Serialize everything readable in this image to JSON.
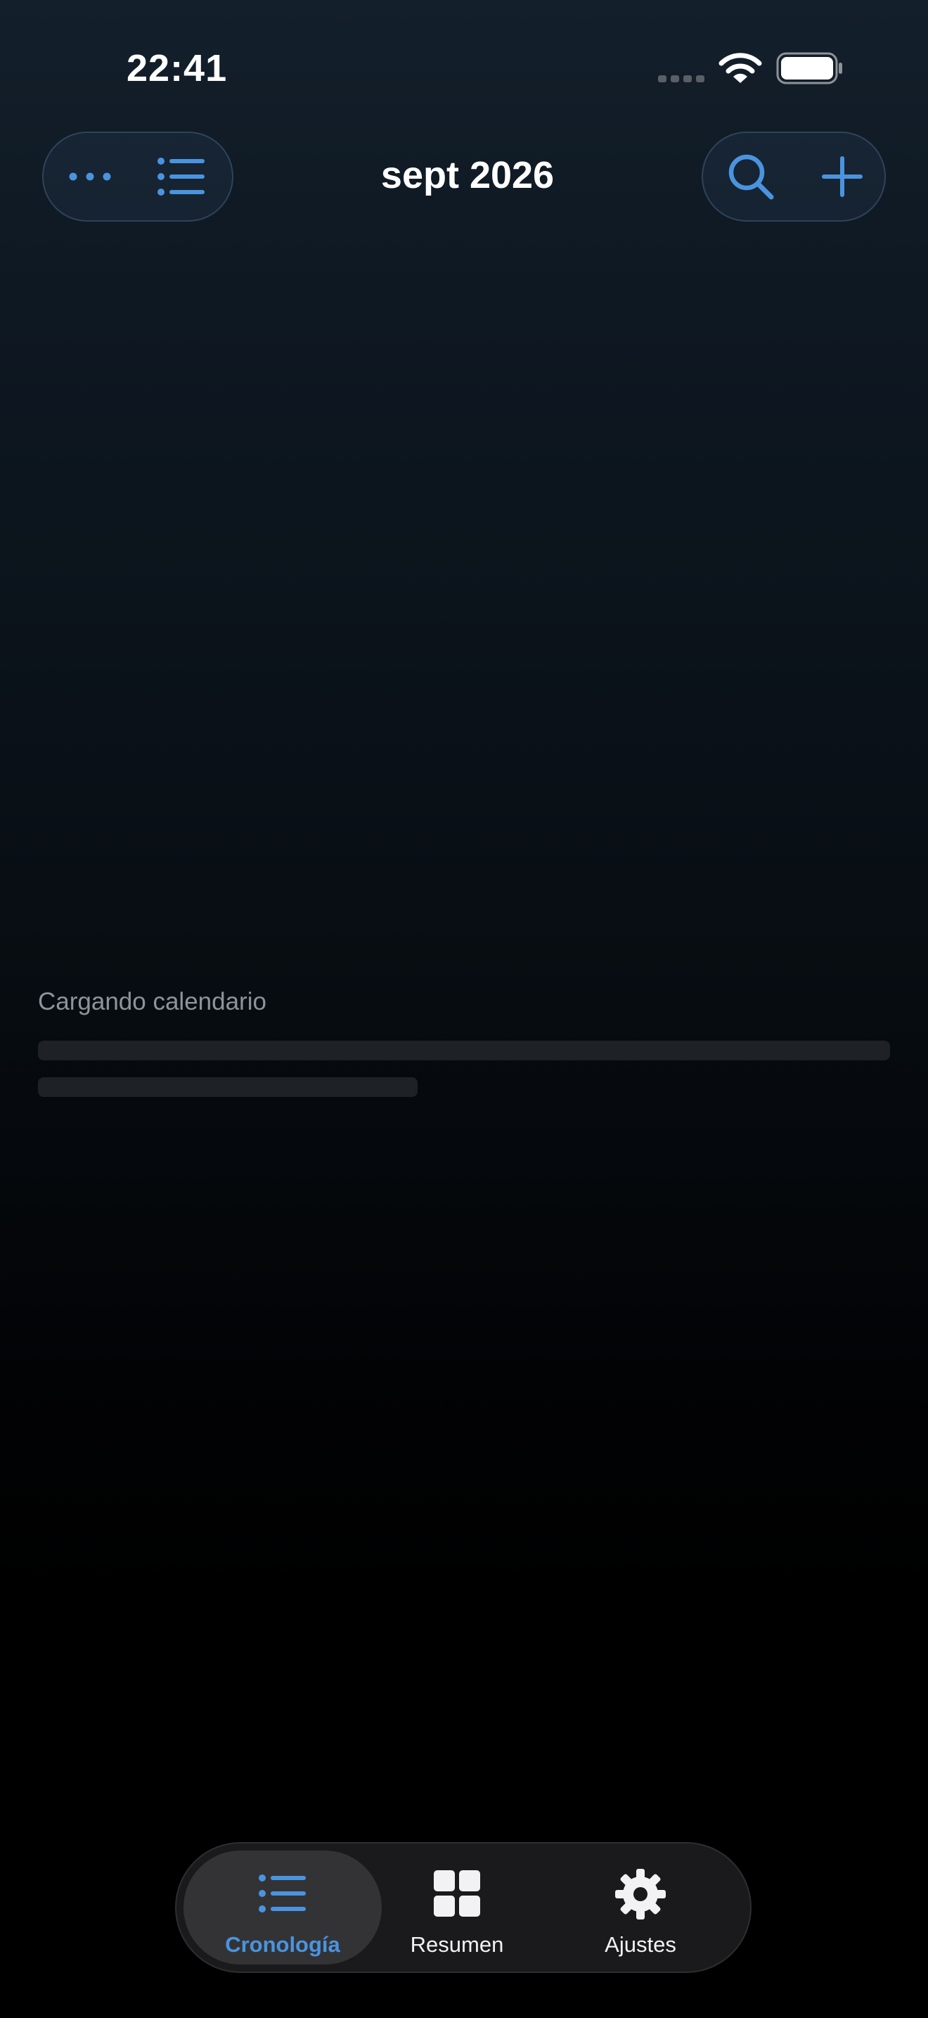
{
  "status_bar": {
    "time": "22:41"
  },
  "header": {
    "month_title": "sept 2026",
    "buttons": {
      "more_icon": "ellipsis-icon",
      "list_icon": "list-icon",
      "search_icon": "search-icon",
      "add_icon": "plus-icon"
    }
  },
  "loading": {
    "label": "Cargando calendario"
  },
  "tab_bar": {
    "tabs": [
      {
        "label": "Cronología",
        "icon": "list-icon",
        "selected": true
      },
      {
        "label": "Resumen",
        "icon": "grid-icon",
        "selected": false
      },
      {
        "label": "Ajustes",
        "icon": "gear-icon",
        "selected": false
      }
    ]
  },
  "colors": {
    "accent": "#4a94df",
    "background_top": "#131f2b",
    "background_bottom": "#000000",
    "tab_bar_bg": "#1a1a1c",
    "selected_tab_bg": "#333336",
    "secondary_text": "#8e949b",
    "skeleton": "#1e2226"
  }
}
